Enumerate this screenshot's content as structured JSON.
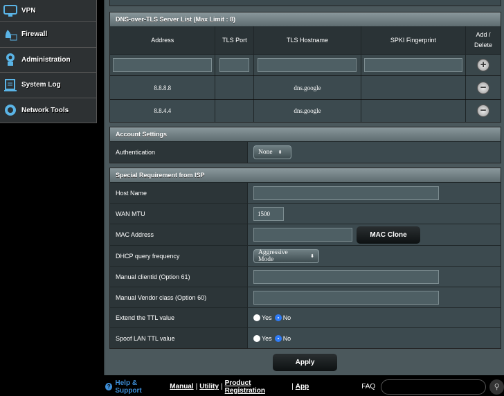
{
  "sidebar": {
    "items": [
      {
        "label": "VPN",
        "icon": "vpn-icon"
      },
      {
        "label": "Firewall",
        "icon": "firewall-icon"
      },
      {
        "label": "Administration",
        "icon": "administration-icon"
      },
      {
        "label": "System Log",
        "icon": "system-log-icon"
      },
      {
        "label": "Network Tools",
        "icon": "network-tools-icon"
      }
    ]
  },
  "dot": {
    "title": "DNS-over-TLS Server List (Max Limit : 8)",
    "columns": [
      "Address",
      "TLS Port",
      "TLS Hostname",
      "SPKI Fingerprint",
      "Add / Delete"
    ],
    "rows": [
      {
        "address": "8.8.8.8",
        "port": "",
        "hostname": "dns.google",
        "spki": ""
      },
      {
        "address": "8.8.4.4",
        "port": "",
        "hostname": "dns.google",
        "spki": ""
      }
    ]
  },
  "account": {
    "title": "Account Settings",
    "auth_label": "Authentication",
    "auth_value": "None"
  },
  "isp": {
    "title": "Special Requirement from ISP",
    "host_label": "Host Name",
    "host_value": "",
    "mtu_label": "WAN MTU",
    "mtu_value": "1500",
    "mac_label": "MAC Address",
    "mac_value": "",
    "mac_clone": "MAC Clone",
    "dhcp_label": "DHCP query frequency",
    "dhcp_value": "Aggressive Mode",
    "clientid_label": "Manual clientid (Option 61)",
    "clientid_value": "",
    "vendor_label": "Manual Vendor class (Option 60)",
    "vendor_value": "",
    "ttl_label": "Extend the TTL value",
    "spoof_label": "Spoof LAN TTL value",
    "yes": "Yes",
    "no": "No",
    "ttl_selected": "No",
    "spoof_selected": "No"
  },
  "apply": "Apply",
  "footer": {
    "help": "Help & Support",
    "links": [
      "Manual",
      "Utility",
      "Product Registration",
      "App"
    ],
    "faq": "FAQ",
    "faq_value": ""
  },
  "colors": {
    "accent": "#2f7bf5",
    "help": "#3d8ed8"
  }
}
